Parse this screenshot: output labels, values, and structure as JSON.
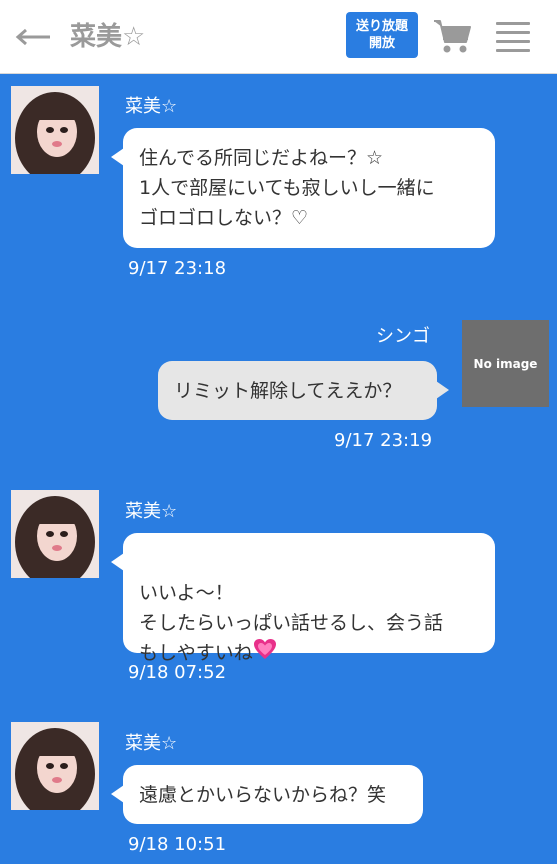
{
  "header": {
    "back_icon": "left-arrow-icon",
    "title": "菜美☆",
    "open_button_line1": "送り放題",
    "open_button_line2": "開放",
    "cart_icon": "cart-icon",
    "menu_icon": "hamburger-icon",
    "accent_color": "#2a7de1"
  },
  "messages": [
    {
      "sender": "菜美☆",
      "side": "left",
      "text": "住んでる所同じだよねー？☆\n1人で部屋にいても寂しいし一緒に\nゴロゴロしない？♡",
      "time": "9/17 23:18"
    },
    {
      "sender": "シンゴ",
      "side": "right",
      "avatar_text": "No image",
      "text": "リミット解除してええか？",
      "time": "9/17 23:19"
    },
    {
      "sender": "菜美☆",
      "side": "left",
      "text_before_emoji": "いいよ〜！\nそしたらいっぱい話せるし、会う話\nもしやすいね",
      "emoji": "sparkling-heart-icon",
      "time": "9/18 07:52"
    },
    {
      "sender": "菜美☆",
      "side": "left",
      "text": "遠慮とかいらないからね？笑",
      "time": "9/18 10:51"
    }
  ],
  "colors": {
    "background": "#2a7de1",
    "bubble_left": "#ffffff",
    "bubble_right": "#e6e6e6"
  }
}
